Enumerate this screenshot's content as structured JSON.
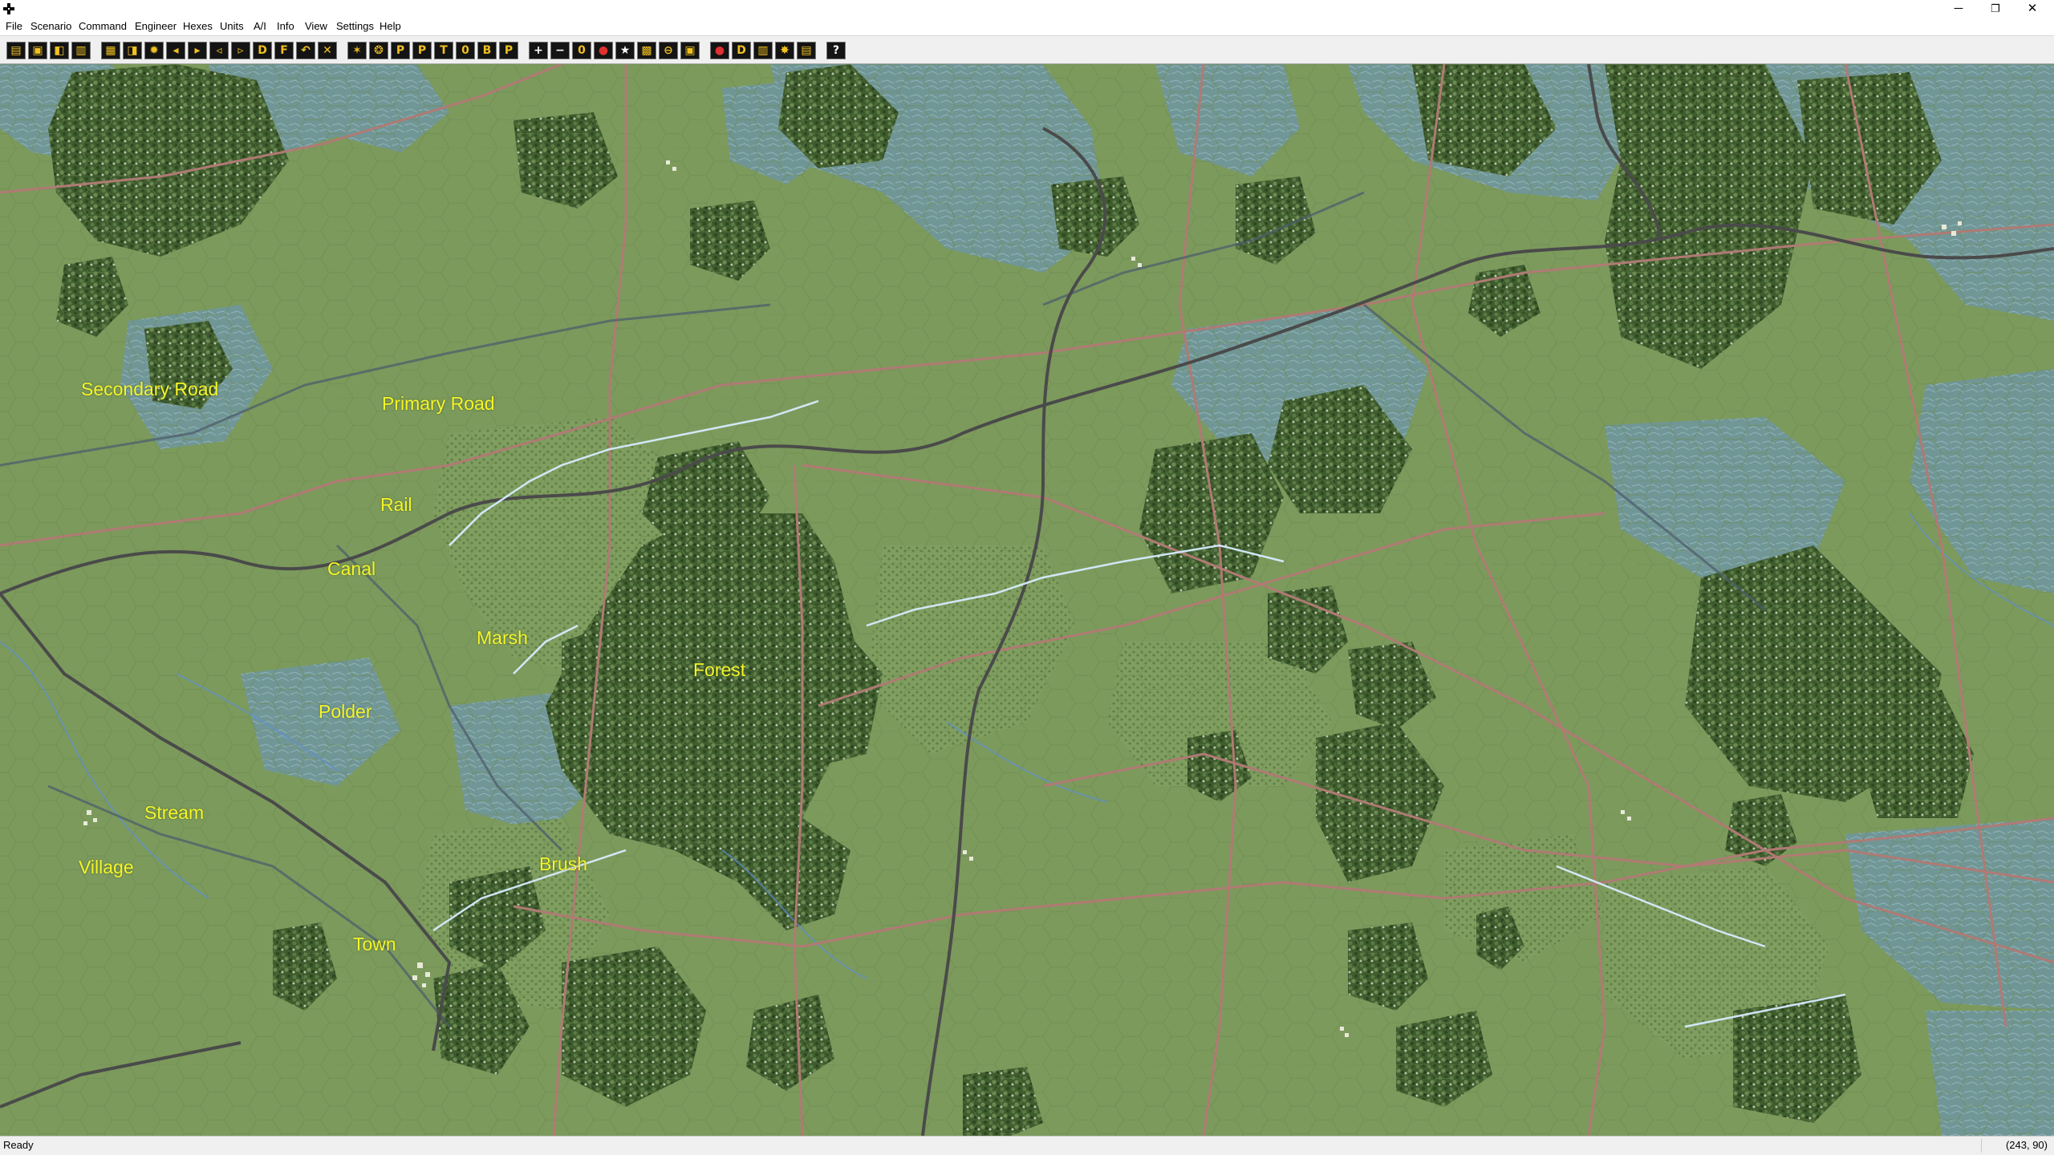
{
  "menu": [
    "File",
    "Scenario",
    "Command",
    "Engineer",
    "Hexes",
    "Units",
    "A/I",
    "Info",
    "View",
    "Settings",
    "Help"
  ],
  "toolbar": {
    "groups": [
      [
        {
          "icon": "open-icon",
          "glyph": "▤"
        },
        {
          "icon": "save-icon",
          "glyph": "▣"
        },
        {
          "icon": "load-icon",
          "glyph": "◧"
        },
        {
          "icon": "print-icon",
          "glyph": "▥"
        }
      ],
      [
        {
          "icon": "first-turn-icon",
          "glyph": "▦"
        },
        {
          "icon": "prev-turn-icon",
          "glyph": "◨"
        },
        {
          "icon": "phase-icon",
          "glyph": "✹"
        },
        {
          "icon": "step-back-icon",
          "glyph": "◂"
        },
        {
          "icon": "step-fwd-icon",
          "glyph": "▸"
        },
        {
          "icon": "rewind-icon",
          "glyph": "◃"
        },
        {
          "icon": "fast-fwd-icon",
          "glyph": "▹"
        },
        {
          "icon": "defensive-fire-icon",
          "glyph": "D"
        },
        {
          "icon": "offensive-fire-icon",
          "glyph": "F"
        },
        {
          "icon": "undo-icon",
          "glyph": "↶"
        },
        {
          "icon": "cancel-icon",
          "glyph": "✕"
        }
      ],
      [
        {
          "icon": "melee-icon",
          "glyph": "✶"
        },
        {
          "icon": "artillery-icon",
          "glyph": "❂"
        },
        {
          "icon": "indirect-fire-icon",
          "glyph": "P"
        },
        {
          "icon": "plot-icon",
          "glyph": "P"
        },
        {
          "icon": "target-icon",
          "glyph": "T"
        },
        {
          "icon": "zero-icon",
          "glyph": "0"
        },
        {
          "icon": "bombard-icon",
          "glyph": "B"
        },
        {
          "icon": "patrol-icon",
          "glyph": "P"
        }
      ],
      [
        {
          "icon": "zoom-in-icon",
          "glyph": "+"
        },
        {
          "icon": "zoom-out-icon",
          "glyph": "−"
        },
        {
          "icon": "reinforce-icon",
          "glyph": "0"
        },
        {
          "icon": "unit-info-icon",
          "glyph": "●"
        },
        {
          "icon": "leader-icon",
          "glyph": "★"
        },
        {
          "icon": "hex-grid-icon",
          "glyph": "▩"
        },
        {
          "icon": "los-icon",
          "glyph": "⊖"
        },
        {
          "icon": "highlight-icon",
          "glyph": "▣"
        }
      ],
      [
        {
          "icon": "artillery-red-icon",
          "glyph": "●"
        },
        {
          "icon": "dialog-icon",
          "glyph": "D"
        },
        {
          "icon": "bars-icon",
          "glyph": "▥"
        },
        {
          "icon": "replay-icon",
          "glyph": "✸"
        },
        {
          "icon": "stacking-icon",
          "glyph": "▤"
        }
      ],
      [
        {
          "icon": "help-icon",
          "glyph": "?"
        }
      ]
    ]
  },
  "map_labels": {
    "secondary_road": "Secondary Road",
    "primary_road": "Primary Road",
    "rail": "Rail",
    "canal": "Canal",
    "marsh": "Marsh",
    "forest": "Forest",
    "polder": "Polder",
    "stream": "Stream",
    "village": "Village",
    "brush": "Brush",
    "town": "Town"
  },
  "colors": {
    "map_base": "#7c9a5c",
    "forest": "#3d5a2d",
    "polder": "#7fa0b0",
    "road_primary": "#b07a74",
    "rail": "#505050",
    "label": "#f5f52a"
  },
  "status": {
    "text": "Ready",
    "coords": "(243, 90)"
  }
}
